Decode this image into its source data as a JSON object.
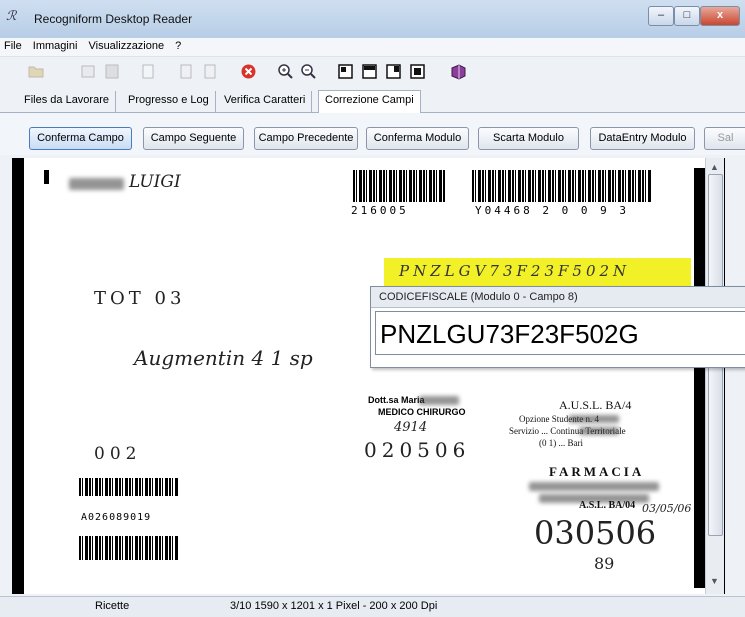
{
  "window": {
    "title": "Recogniform Desktop Reader",
    "app_icon_glyph": "ℛ",
    "controls": {
      "minimize": "–",
      "maximize": "□",
      "close": "x"
    }
  },
  "menu": [
    "File",
    "Immagini",
    "Visualizzazione",
    "?"
  ],
  "toolbar": {
    "icons": [
      "open-folder-icon",
      "scan-icon",
      "save-icon",
      "page-icon",
      "prev-page-icon",
      "next-page-icon",
      "stop-icon",
      "zoom-in-icon",
      "zoom-out-icon",
      "fit-page-icon",
      "fit-width-icon",
      "fit-height-icon",
      "actual-size-icon",
      "book-icon"
    ]
  },
  "tabs": [
    {
      "label": "Files da Lavorare",
      "active": false
    },
    {
      "label": "Progresso e Log",
      "active": false
    },
    {
      "label": "Verifica Caratteri",
      "active": false
    },
    {
      "label": "Correzione Campi",
      "active": true
    }
  ],
  "actions": [
    "Conferma Campo",
    "Campo Seguente",
    "Campo Precedente",
    "Conferma Modulo",
    "Scarta Modulo",
    "DataEntry Modulo",
    "Sal"
  ],
  "document": {
    "name_handwritten": "LUIGI",
    "barcode1_text": "216005",
    "barcode2_text": "Y04468 2 0 0 9 3",
    "highlighted_cf_handwritten": "PNZLGV73F23F502N",
    "tot": "TOT 03",
    "handwritten_note": "Augmentin 4 1 sp",
    "doctor_lines": [
      "Dott.sa Maria",
      "MEDICO CHIRURGO"
    ],
    "doctor_handwritten": "4914",
    "code_handwritten": "020506",
    "asl_stamp": [
      "A.U.S.L. BA/4"
    ],
    "asl_stamp_partial": [
      "Opzione  Studente n. 4",
      "Servizio  ...  Continua Territoriale",
      "(0 1)  ...  Bari"
    ],
    "farmacia": "FARMACIA",
    "asl_bottom": "A.S.L. BA/04",
    "date_handwritten": "03/05/06",
    "big_number": "030506",
    "small_number": "89",
    "count_hand": "002",
    "barcode3_label": "A026089019"
  },
  "popup": {
    "header": "CODICEFISCALE (Modulo 0 - Campo 8)",
    "value": "PNZLGU73F23F502G"
  },
  "status": {
    "left": "Ricette",
    "right": "3/10 1590 x 1201 x 1 Pixel - 200 x 200 Dpi"
  }
}
